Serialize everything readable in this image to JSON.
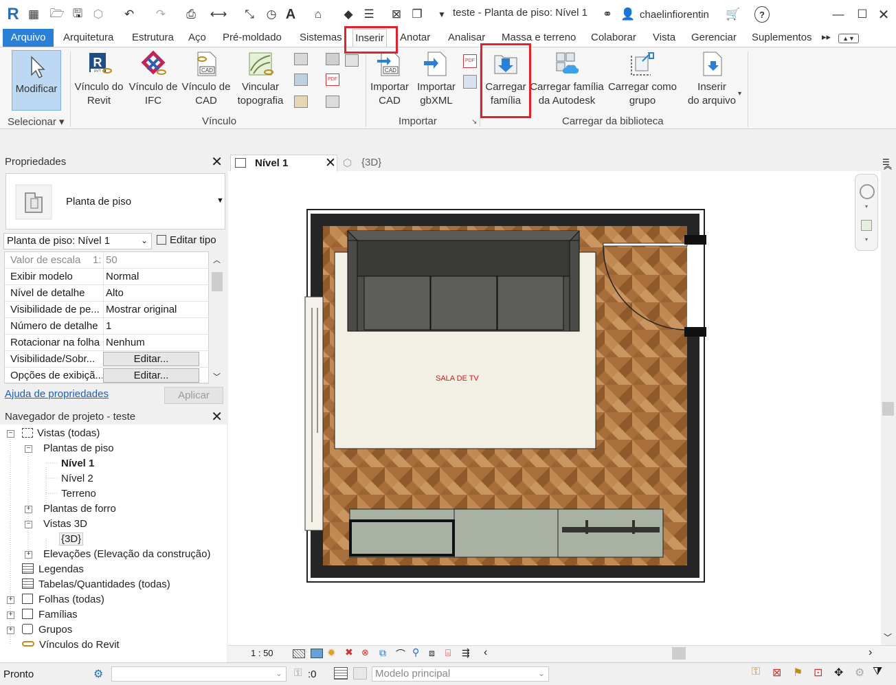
{
  "title_bar": {
    "document_title": "teste - Planta de piso: Nível 1",
    "user": "chaelinfiorentin",
    "help_label": "?"
  },
  "ribbon_tabs": [
    "Arquivo",
    "Arquitetura",
    "Estrutura",
    "Aço",
    "Pré-moldado",
    "Sistemas",
    "Inserir",
    "Anotar",
    "Analisar",
    "Massa e terreno",
    "Colaborar",
    "Vista",
    "Gerenciar",
    "Suplementos"
  ],
  "active_tab": "Inserir",
  "ribbon": {
    "selecionar": {
      "modificar": "Modificar",
      "panel_label": "Selecionar"
    },
    "vinculo": {
      "revit": [
        "Vínculo do",
        "Revit"
      ],
      "ifc": [
        "Vínculo de",
        "IFC"
      ],
      "cad": [
        "Vínculo de",
        "CAD"
      ],
      "topografia": [
        "Vincular",
        "topografia"
      ],
      "panel_label": "Vínculo"
    },
    "importar": {
      "cad": [
        "Importar",
        "CAD"
      ],
      "gbxml": [
        "Importar",
        "gbXML"
      ],
      "panel_label": "Importar"
    },
    "biblioteca": {
      "carregar_familia": [
        "Carregar",
        "família"
      ],
      "carregar_autodesk": [
        "Carregar família",
        "da Autodesk"
      ],
      "carregar_grupo": [
        "Carregar como",
        "grupo"
      ],
      "inserir_arquivo": [
        "Inserir",
        "do arquivo"
      ],
      "panel_label": "Carregar da biblioteca"
    }
  },
  "properties": {
    "header": "Propriedades",
    "type_name": "Planta de piso",
    "instance_selector": "Planta de piso: Nível 1",
    "edit_type": "Editar tipo",
    "rows": [
      {
        "key": "Valor de escala",
        "prefix": "1:",
        "value": "50"
      },
      {
        "key": "Exibir modelo",
        "value": "Normal"
      },
      {
        "key": "Nível de detalhe",
        "value": "Alto"
      },
      {
        "key": "Visibilidade de pe...",
        "value": "Mostrar original"
      },
      {
        "key": "Número de detalhe",
        "value": "1"
      },
      {
        "key": "Rotacionar na folha",
        "value": "Nenhum"
      },
      {
        "key": "Visibilidade/Sobr...",
        "button": "Editar..."
      },
      {
        "key": "Opções de exibiçã...",
        "button": "Editar..."
      }
    ],
    "help_link": "Ajuda de propriedades",
    "apply": "Aplicar"
  },
  "navigator": {
    "header": "Navegador de projeto - teste",
    "items": [
      {
        "label": "Vistas (todas)"
      },
      {
        "label": "Plantas de piso"
      },
      {
        "label": "Nível 1"
      },
      {
        "label": "Nível 2"
      },
      {
        "label": "Terreno"
      },
      {
        "label": "Plantas de forro"
      },
      {
        "label": "Vistas 3D"
      },
      {
        "label": "{3D}"
      },
      {
        "label": "Elevações (Elevação da construção)"
      },
      {
        "label": "Legendas"
      },
      {
        "label": "Tabelas/Quantidades (todas)"
      },
      {
        "label": "Folhas (todas)"
      },
      {
        "label": "Famílias"
      },
      {
        "label": "Grupos"
      },
      {
        "label": "Vínculos do Revit"
      }
    ]
  },
  "view_tabs": [
    {
      "label": "Nível 1",
      "active": true
    },
    {
      "label": "{3D}",
      "active": false
    }
  ],
  "canvas": {
    "room_label": "SALA DE TV"
  },
  "view_control_bar": {
    "scale": "1 : 50"
  },
  "status_bar": {
    "status": "Pronto",
    "selection_count": ":0",
    "model": "Modelo principal"
  },
  "colors": {
    "accent": "#2a7fd6",
    "highlight_box": "#e0232b",
    "floor": "#b07a44",
    "wall": "#222222",
    "rug": "#f0ede2",
    "sofa": "#4e4e4a",
    "cabinet": "#a8b0a2",
    "room_label": "#dd1111"
  }
}
